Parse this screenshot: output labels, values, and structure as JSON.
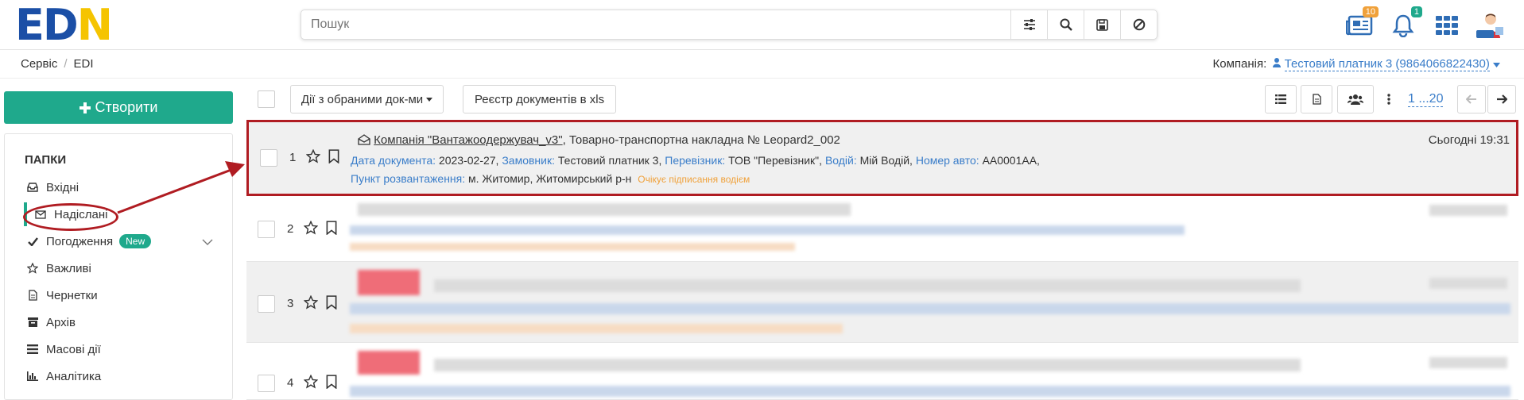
{
  "logo": {
    "e": "E",
    "d": "D",
    "n": "N"
  },
  "search": {
    "placeholder": "Пошук"
  },
  "header": {
    "archive_badge": "10",
    "bell_badge": "1"
  },
  "breadcrumb": {
    "items": [
      "Сервіс",
      "EDI"
    ]
  },
  "company": {
    "label": "Компанія:",
    "value": "Тестовий платник 3 (9864066822430)"
  },
  "sidebar": {
    "create_label": "Створити",
    "folders_title": "ПАПКИ",
    "items": [
      {
        "label": "Вхідні",
        "icon": "inbox-icon"
      },
      {
        "label": "Надіслані",
        "icon": "envelope-icon"
      },
      {
        "label": "Погодження",
        "icon": "check-icon",
        "badge": "New"
      },
      {
        "label": "Важливі",
        "icon": "star-icon"
      },
      {
        "label": "Чернетки",
        "icon": "file-icon"
      },
      {
        "label": "Архів",
        "icon": "archive-icon"
      },
      {
        "label": "Масові дії",
        "icon": "list-icon"
      },
      {
        "label": "Аналітика",
        "icon": "bar-chart-icon"
      }
    ]
  },
  "toolbar": {
    "bulk_actions_label": "Дії з обраними док-ми",
    "export_label": "Реєстр документів в xls",
    "pager_label": "1 ...20"
  },
  "documents": [
    {
      "num": "1",
      "company": "Компанія \"Вантажоодержувач_v3\"",
      "title": ", Товарно-транспортна накладна № Leopard2_002",
      "time": "Сьогодні 19:31",
      "date_label": "Дата документа:",
      "date": "2023-02-27,",
      "customer_label": "Замовник:",
      "customer": "Тестовий платник 3,",
      "carrier_label": "Перевізник:",
      "carrier": "ТОВ \"Перевізник\",",
      "driver_label": "Водій:",
      "driver": "Мій Водій,",
      "car_label": "Номер авто:",
      "car": "АА0001АА,",
      "unload_label": "Пункт розвантаження:",
      "unload": "м. Житомир, Житомирський р-н",
      "status": "Очікує підписання водієм"
    },
    {
      "num": "2"
    },
    {
      "num": "3"
    },
    {
      "num": "4"
    }
  ]
}
